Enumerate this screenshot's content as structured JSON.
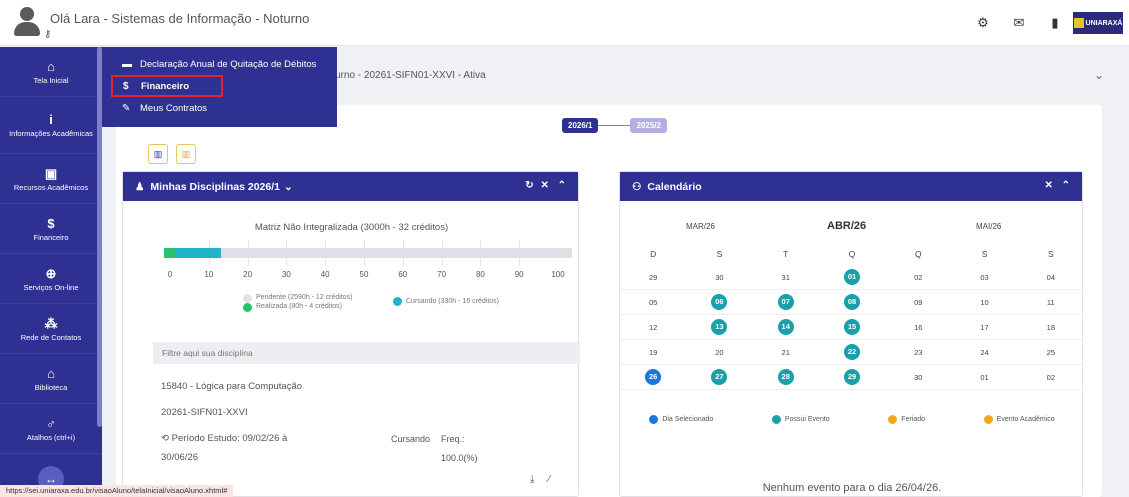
{
  "header": {
    "greeting": "Olá Lara - Sistemas de Informação - Noturno",
    "brand": "UNIARAXÁ"
  },
  "sidebar": {
    "items": [
      {
        "icon": "home-icon",
        "glyph": "⌂",
        "label": "Tela Inicial"
      },
      {
        "icon": "info-icon",
        "glyph": "i",
        "label": "Informações Acadêmicas"
      },
      {
        "icon": "book-icon",
        "glyph": "▣",
        "label": "Recursos Acadêmicos"
      },
      {
        "icon": "dollar-icon",
        "glyph": "$",
        "label": "Financeiro"
      },
      {
        "icon": "globe-icon",
        "glyph": "⊕",
        "label": "Serviços On-line"
      },
      {
        "icon": "people-icon",
        "glyph": "⁂",
        "label": "Rede de Contatos"
      },
      {
        "icon": "library-icon",
        "glyph": "⌂",
        "label": "Biblioteca"
      },
      {
        "icon": "shortcut-icon",
        "glyph": "♂",
        "label": "Atalhos (ctrl+i)"
      }
    ],
    "toggle_glyph": "↔"
  },
  "dropdown": {
    "items": [
      {
        "icon": "card-icon",
        "glyph": "▬",
        "label": "Declaração Anual de Quitação de Débitos"
      },
      {
        "icon": "hand-money-icon",
        "glyph": "$",
        "label": "Financeiro"
      },
      {
        "icon": "contract-icon",
        "glyph": "✎",
        "label": "Meus Contratos"
      }
    ]
  },
  "selector": {
    "text": "urno - 20261-SIFN01-XXVI - Ativa"
  },
  "timeline": {
    "active": "2026/1",
    "next": "2025/2"
  },
  "disciplines": {
    "title": "Minhas Disciplinas  2026/1",
    "matrix_title": "Matriz Não Integralizada (3000h - 32 créditos)",
    "progress": {
      "realizada_pct": 3,
      "cursando_pct": 11
    },
    "ticks": [
      "0",
      "10",
      "20",
      "30",
      "40",
      "50",
      "60",
      "70",
      "80",
      "90",
      "100"
    ],
    "legend": {
      "pendente": "Pendente (2590h - 12 créditos)",
      "realizada": "Realizada (80h - 4 créditos)",
      "cursando": "Cursando (330h - 16 créditos)"
    },
    "filter_placeholder": "Filtre aqui sua disciplina",
    "course": {
      "name": "15840 - Lógica para Computação",
      "code": "20261-SIFN01-XXVI",
      "period": "Período Estudo: 09/02/26 à",
      "period_end": "30/06/26",
      "status": "Cursando",
      "freq_label": "Freq.:",
      "freq_value": "100.0(%)"
    }
  },
  "calendar": {
    "title": "Calendário",
    "prev_month": "MAR/26",
    "current_month": "ABR/26",
    "next_month": "MAI/26",
    "weekdays": [
      "D",
      "S",
      "T",
      "Q",
      "Q",
      "S",
      "S"
    ],
    "weeks": [
      [
        {
          "d": "29"
        },
        {
          "d": "30"
        },
        {
          "d": "31"
        },
        {
          "d": "01",
          "ev": true
        },
        {
          "d": "02"
        },
        {
          "d": "03"
        },
        {
          "d": "04"
        }
      ],
      [
        {
          "d": "05"
        },
        {
          "d": "06",
          "ev": true
        },
        {
          "d": "07",
          "ev": true
        },
        {
          "d": "08",
          "ev": true
        },
        {
          "d": "09"
        },
        {
          "d": "10"
        },
        {
          "d": "11"
        }
      ],
      [
        {
          "d": "12"
        },
        {
          "d": "13",
          "ev": true
        },
        {
          "d": "14",
          "ev": true
        },
        {
          "d": "15",
          "ev": true
        },
        {
          "d": "16"
        },
        {
          "d": "17"
        },
        {
          "d": "18"
        }
      ],
      [
        {
          "d": "19"
        },
        {
          "d": "20"
        },
        {
          "d": "21"
        },
        {
          "d": "22",
          "ev": true
        },
        {
          "d": "23"
        },
        {
          "d": "24"
        },
        {
          "d": "25"
        }
      ],
      [
        {
          "d": "26",
          "sel": true
        },
        {
          "d": "27",
          "ev": true
        },
        {
          "d": "28",
          "ev": true
        },
        {
          "d": "29",
          "ev": true
        },
        {
          "d": "30"
        },
        {
          "d": "01"
        },
        {
          "d": "02"
        }
      ]
    ],
    "legend": [
      "Dia Selecionado",
      "Possui Evento",
      "Feriado",
      "Evento Acadêmico"
    ],
    "no_events": "Nenhum evento para o dia 26/04/26."
  },
  "status_url": "https://sei.uniaraxa.edu.br/visaoAluno/telaInicial/visaoAluno.xhtml#"
}
